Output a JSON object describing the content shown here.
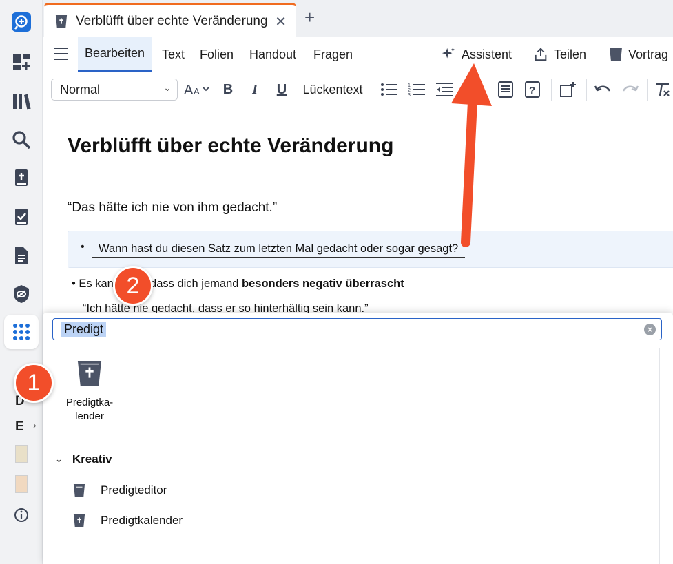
{
  "tab": {
    "title": "Verblüfft über echte Veränderung",
    "close": "✕",
    "add": "+"
  },
  "menu": {
    "tabs": [
      "Bearbeiten",
      "Text",
      "Folien",
      "Handout",
      "Fragen"
    ],
    "assistant": "Assistent",
    "share": "Teilen",
    "present": "Vortrag"
  },
  "toolbar": {
    "style": "Normal",
    "cloze": "Lückentext"
  },
  "doc": {
    "title": "Verblüfft über echte Veränderung",
    "quote": "“Das hätte ich nie von ihm gedacht.”",
    "bullet1": "Wann hast du diesen Satz zum letzten Mal gedacht oder sogar gesagt?",
    "bullet2_prefix": "Es kann sein, dass dich jemand",
    "bullet2_bold": "besonders negativ überrascht",
    "quote2": "“Ich hätte nie gedacht, dass er so hinterhältig sein kann.”"
  },
  "sidebar": {
    "letters": [
      "D",
      "E"
    ]
  },
  "search": {
    "value": "Predigt"
  },
  "results": {
    "tile_label_line1": "Predigtka-",
    "tile_label_line2": "lender",
    "section": "Kreativ",
    "items": [
      "Predigteditor",
      "Predigtkalender"
    ]
  },
  "annotations": {
    "badge1": "1",
    "badge2": "2"
  },
  "colors": {
    "accent": "#2a63c7",
    "tab_top": "#f06b1f",
    "annotation": "#f24e2a"
  }
}
